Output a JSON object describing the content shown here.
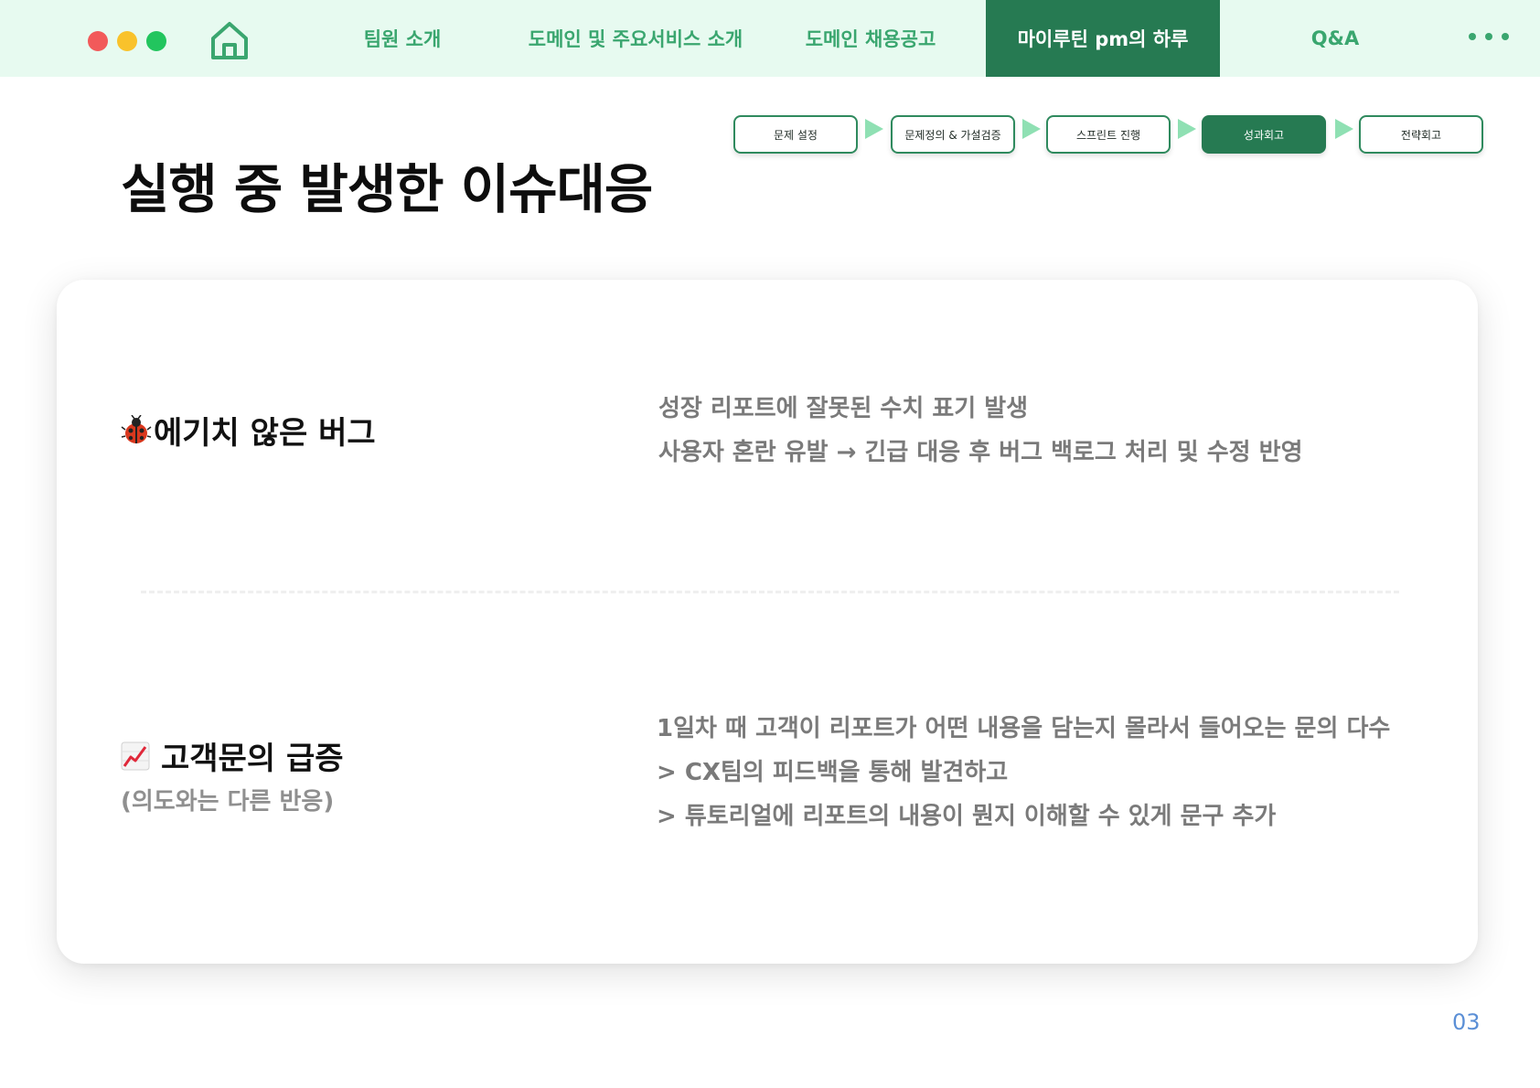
{
  "nav": {
    "items": [
      {
        "label": "팀원 소개"
      },
      {
        "label": "도메인 및 주요서비스 소개"
      },
      {
        "label": "도메인 채용공고"
      },
      {
        "label": "마이루틴 pm의 하루"
      },
      {
        "label": "Q&A"
      }
    ],
    "active_index": 3
  },
  "steps": {
    "items": [
      {
        "label": "문제 설정"
      },
      {
        "label": "문제정의 & 가설검증"
      },
      {
        "label": "스프린트 진행"
      },
      {
        "label": "성과회고"
      },
      {
        "label": "전략회고"
      }
    ],
    "active_index": 3
  },
  "page": {
    "title": "실행 중 발생한 이슈대응",
    "number": "03"
  },
  "issues": [
    {
      "icon": "ladybug-icon",
      "title": "에기치 않은 버그",
      "lines": [
        "성장 리포트에 잘못된 수치 표기 발생",
        "사용자 혼란 유발 → 긴급 대응 후 버그 백로그 처리 및 수정 반영"
      ]
    },
    {
      "icon": "chart-increasing-icon",
      "title": "고객문의 급증",
      "subtitle": "(의도와는 다른 반응)",
      "lines": [
        "1일차 때 고객이 리포트가 어떤 내용을 담는지 몰라서 들어오는 문의 다수",
        "> CX팀의 피드백을 통해 발견하고",
        "> 튜토리얼에 리포트의 내용이 뭔지 이해할 수 있게 문구 추가"
      ]
    }
  ],
  "colors": {
    "nav_bg": "#e7faf0",
    "accent": "#267a52",
    "nav_text": "#3aa66f",
    "arrow": "#8fe0b3",
    "page_number": "#5b8fd6"
  }
}
